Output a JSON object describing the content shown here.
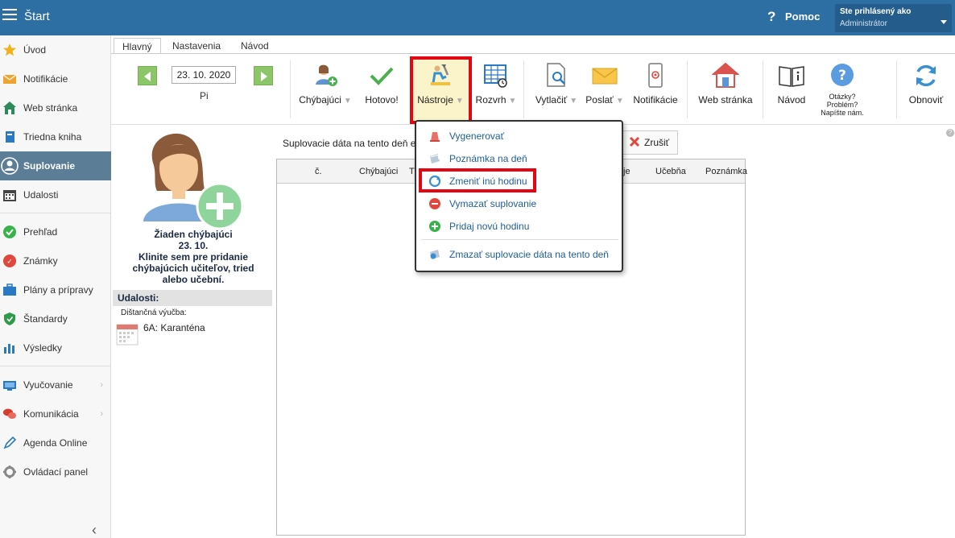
{
  "topbar": {
    "title": "Štart",
    "help_label": "Pomoc",
    "user_line1": "Ste prihlásený ako",
    "user_line2": "Administrátor"
  },
  "sidebar": {
    "items": [
      {
        "label": "Úvod",
        "icon": "star-icon"
      },
      {
        "label": "Notifikácie",
        "icon": "envelope-icon"
      },
      {
        "label": "Web stránka",
        "icon": "home-icon"
      },
      {
        "label": "Triedna kniha",
        "icon": "book-icon"
      },
      {
        "label": "Suplovanie",
        "icon": "person-icon"
      },
      {
        "label": "Udalosti",
        "icon": "calendar-icon"
      },
      {
        "label": "Prehľad",
        "icon": "check-circle-icon"
      },
      {
        "label": "Známky",
        "icon": "grade-icon"
      },
      {
        "label": "Plány a prípravy",
        "icon": "briefcase-icon"
      },
      {
        "label": "Štandardy",
        "icon": "shield-icon"
      },
      {
        "label": "Výsledky",
        "icon": "bar-chart-icon"
      },
      {
        "label": "Vyučovanie",
        "icon": "board-icon"
      },
      {
        "label": "Komunikácia",
        "icon": "chat-icon"
      },
      {
        "label": "Agenda Online",
        "icon": "pen-icon"
      },
      {
        "label": "Ovládací panel",
        "icon": "gear-icon"
      }
    ]
  },
  "tabs": [
    {
      "label": "Hlavný"
    },
    {
      "label": "Nastavenia"
    },
    {
      "label": "Návod"
    }
  ],
  "toolbar": {
    "date_value": "23. 10. 2020",
    "day_label": "Pi",
    "buttons": [
      {
        "label": "Chýbajúci",
        "icon": "person-add-icon"
      },
      {
        "label": "Hotovo!",
        "icon": "checkmark-icon"
      },
      {
        "label": "Nástroje",
        "icon": "tools-icon"
      },
      {
        "label": "Rozvrh",
        "icon": "timetable-icon"
      },
      {
        "label": "Vytlačiť",
        "icon": "print-preview-icon"
      },
      {
        "label": "Poslať",
        "icon": "envelope-icon"
      },
      {
        "label": "Notifikácie",
        "icon": "phone-icon"
      },
      {
        "label": "Web stránka",
        "icon": "house-icon"
      },
      {
        "label": "Návod",
        "icon": "manual-icon"
      },
      {
        "label_l1": "Otázky?",
        "label_l2": "Problém?",
        "label_l3": "Napíšte nám.",
        "icon": "question-icon"
      },
      {
        "label": "Obnoviť",
        "icon": "refresh-icon"
      }
    ]
  },
  "left_panel": {
    "missing_title": "Žiaden chýbajúci",
    "missing_date": "23. 10.",
    "missing_hint_l1": "Klinite sem pre pridanie",
    "missing_hint_l2": "chýbajúcich učiteľov, tried",
    "missing_hint_l3": "alebo učební.",
    "events_header": "Udalosti:",
    "events_sub": "Dištančná výučba:",
    "event_text": "6A: Karanténa"
  },
  "main": {
    "subs_title": "Suplovacie dáta na tento deň e",
    "cancel_label": "Zrušiť",
    "grid_headers": [
      "č.",
      "Chýbajúci",
      "T",
      "je",
      "Učebňa",
      "Poznámka"
    ]
  },
  "menu": {
    "items": [
      {
        "label": "Vygenerovať",
        "icon": "generate-icon"
      },
      {
        "label": "Poznámka na deň",
        "icon": "note-icon"
      },
      {
        "label": "Zmeniť inú hodinu",
        "icon": "change-icon"
      },
      {
        "label": "Vymazať suplovanie",
        "icon": "delete-icon"
      },
      {
        "label": "Pridaj novú hodinu",
        "icon": "add-icon"
      },
      {
        "label": "Zmazať suplovacie dáta na tento deň",
        "icon": "erase-icon"
      }
    ]
  },
  "colors": {
    "topbar": "#2e6fa3",
    "active_sidebar": "#5b7d96",
    "highlight": "#e30613",
    "menu_text": "#1f5f95"
  }
}
